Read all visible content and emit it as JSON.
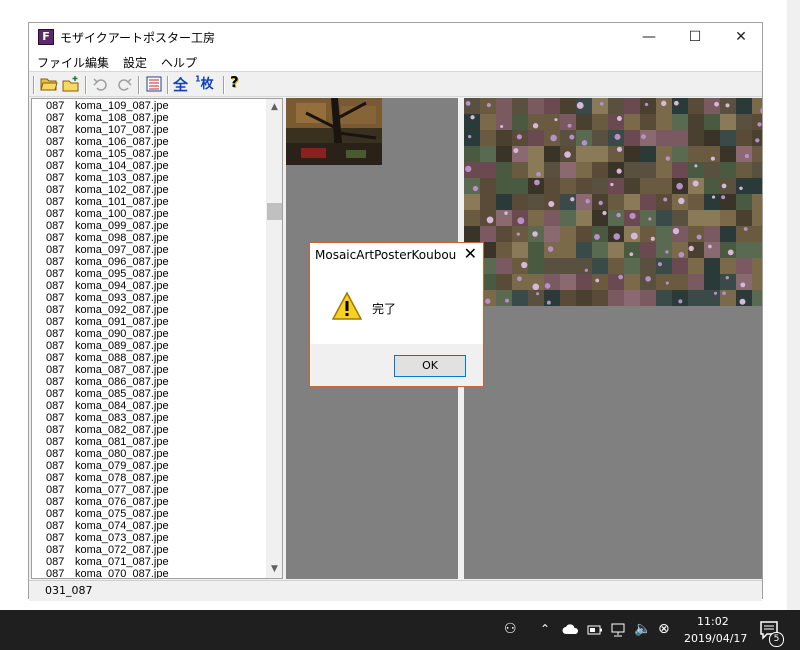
{
  "window": {
    "title": "モザイクアートポスター工房",
    "app_icon_letter": "F"
  },
  "titlebar_buttons": {
    "minimize": "—",
    "maximize": "☐",
    "close": "✕"
  },
  "menu": [
    "ファイル",
    "編集",
    "設定",
    "ヘルプ"
  ],
  "toolbar": {
    "all_label": "全",
    "one_label_sup": "1",
    "one_label": "枚",
    "help_label": "?"
  },
  "file_list": {
    "num": "087",
    "items": [
      "koma_109_087.jpe",
      "koma_108_087.jpe",
      "koma_107_087.jpe",
      "koma_106_087.jpe",
      "koma_105_087.jpe",
      "koma_104_087.jpe",
      "koma_103_087.jpe",
      "koma_102_087.jpe",
      "koma_101_087.jpe",
      "koma_100_087.jpe",
      "koma_099_087.jpe",
      "koma_098_087.jpe",
      "koma_097_087.jpe",
      "koma_096_087.jpe",
      "koma_095_087.jpe",
      "koma_094_087.jpe",
      "koma_093_087.jpe",
      "koma_092_087.jpe",
      "koma_091_087.jpe",
      "koma_090_087.jpe",
      "koma_089_087.jpe",
      "koma_088_087.jpe",
      "koma_087_087.jpe",
      "koma_086_087.jpe",
      "koma_085_087.jpe",
      "koma_084_087.jpe",
      "koma_083_087.jpe",
      "koma_082_087.jpe",
      "koma_081_087.jpe",
      "koma_080_087.jpe",
      "koma_079_087.jpe",
      "koma_078_087.jpe",
      "koma_077_087.jpe",
      "koma_076_087.jpe",
      "koma_075_087.jpe",
      "koma_074_087.jpe",
      "koma_073_087.jpe",
      "koma_072_087.jpe",
      "koma_071_087.jpe",
      "koma_070_087.jpe"
    ]
  },
  "status": "031_087",
  "dialog": {
    "title": "MosaicArtPosterKoubou",
    "message": "完了",
    "ok_label": "OK",
    "close_glyph": "✕"
  },
  "taskbar": {
    "time": "11:02",
    "date": "2019/04/17",
    "notification_count": "5"
  },
  "colors": {
    "panel_gray": "#808080",
    "dialog_border": "#c86430",
    "ok_focus": "#0078d7",
    "taskbar": "#1f1f1f"
  }
}
